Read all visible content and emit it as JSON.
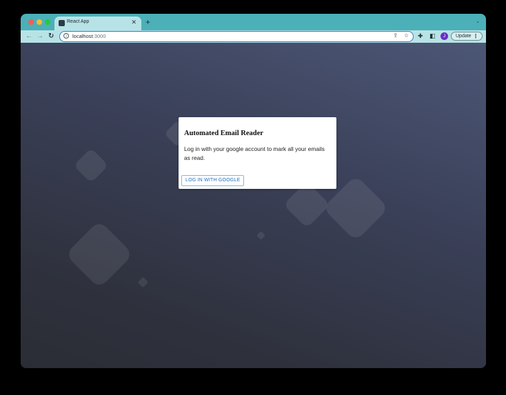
{
  "browser": {
    "tab_title": "React App",
    "tab_close": "✕",
    "new_tab": "+",
    "tab_search": "⌄",
    "address": {
      "host": "localhost",
      "port": ":3000"
    },
    "nav": {
      "back": "←",
      "forward": "→",
      "reload": "↻"
    },
    "avatar_initial": "J",
    "update_label": "Update",
    "menu": "⋮"
  },
  "icons": {
    "favicon": "react-app-favicon",
    "info": "info-icon",
    "share": "share-icon",
    "star": "bookmark-star-icon",
    "extensions": "puzzle-piece-icon",
    "side_panel": "side-panel-icon"
  },
  "colors": {
    "tab_strip": "#4cb0b8",
    "toolbar": "#b8e3e6",
    "button_text": "#1a6fc4",
    "avatar": "#6a2fc7"
  },
  "app": {
    "title": "Automated Email Reader",
    "description": "Log in with your google account to mark all your emails as read.",
    "login_button": "LOG IN WITH GOOGLE"
  }
}
